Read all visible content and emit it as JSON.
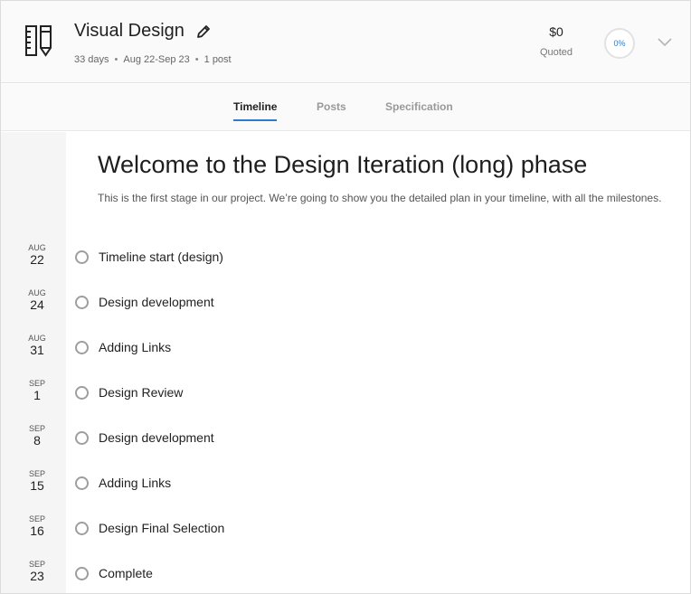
{
  "header": {
    "title": "Visual Design",
    "meta": {
      "duration": "33 days",
      "range": "Aug 22-Sep 23",
      "posts": "1 post"
    },
    "price": "$0",
    "price_label": "Quoted",
    "progress": "0%",
    "icons": {
      "phase": "ruler-pencil-icon",
      "edit": "pencil-icon",
      "expand": "chevron-down-icon"
    }
  },
  "tabs": [
    {
      "label": "Timeline",
      "active": true
    },
    {
      "label": "Posts",
      "active": false
    },
    {
      "label": "Specification",
      "active": false
    }
  ],
  "phase": {
    "heading": "Welcome to the Design Iteration (long) phase",
    "description": "This is the first stage in our project. We’re going to show you the detailed plan in your timeline, with all the milestones."
  },
  "milestones": [
    {
      "month": "AUG",
      "day": "22",
      "label": "Timeline start (design)"
    },
    {
      "month": "AUG",
      "day": "24",
      "label": "Design development"
    },
    {
      "month": "AUG",
      "day": "31",
      "label": "Adding Links"
    },
    {
      "month": "SEP",
      "day": "1",
      "label": "Design Review"
    },
    {
      "month": "SEP",
      "day": "8",
      "label": "Design development"
    },
    {
      "month": "SEP",
      "day": "15",
      "label": "Adding Links"
    },
    {
      "month": "SEP",
      "day": "16",
      "label": "Design Final Selection"
    },
    {
      "month": "SEP",
      "day": "23",
      "label": "Complete"
    }
  ],
  "colors": {
    "accent": "#2b7bd0",
    "rail": "#f5f5f5",
    "header": "#fafafa"
  }
}
